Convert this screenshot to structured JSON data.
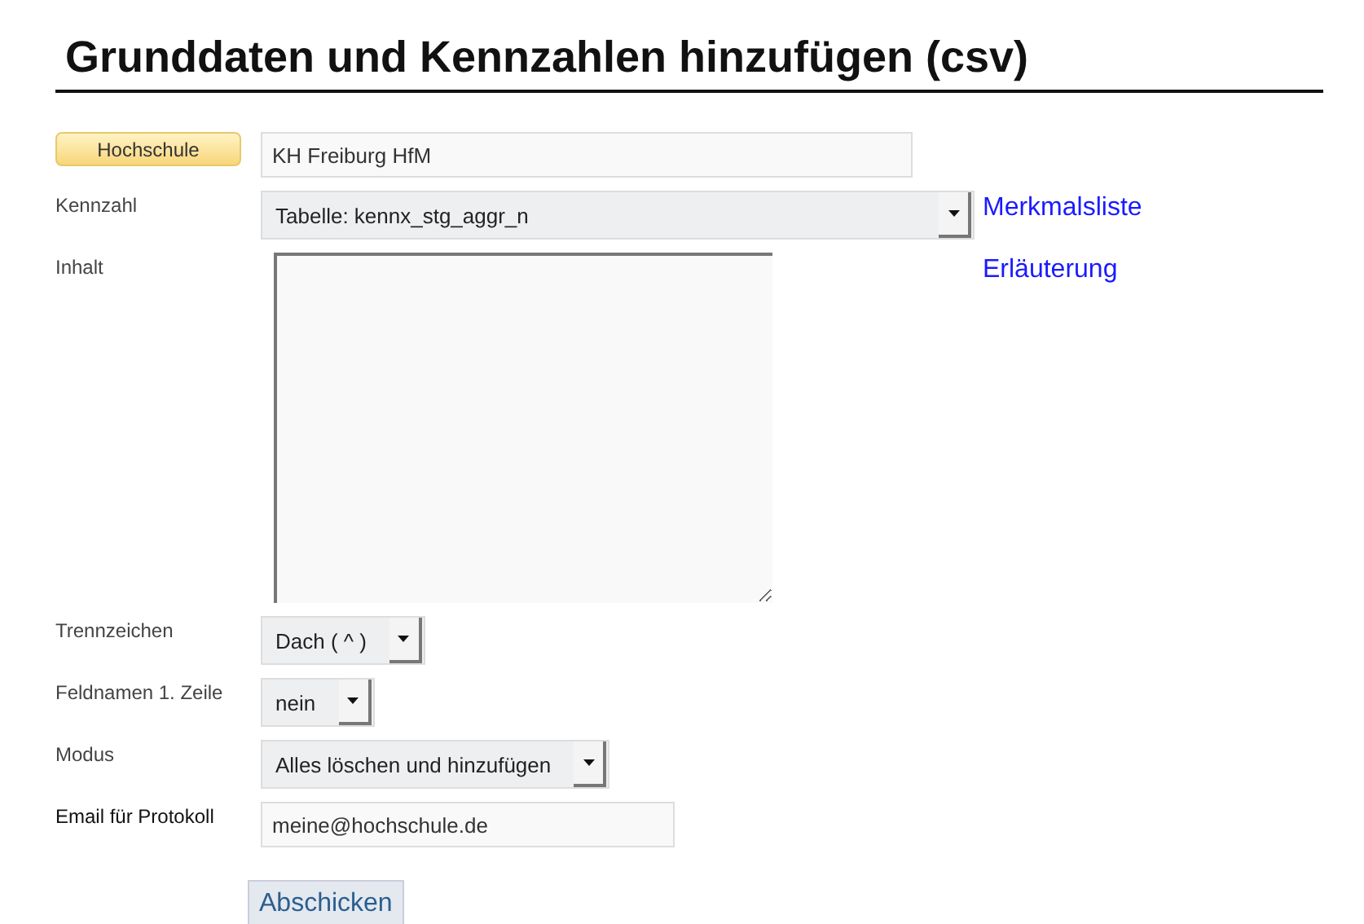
{
  "title": "Grunddaten und Kennzahlen hinzufügen (csv)",
  "fields": [
    {
      "label": {
        "kind": "button",
        "text": "Hochschule"
      },
      "kind": "text",
      "value": "KH Freiburg HfM"
    },
    {
      "label": {
        "kind": "text",
        "text": "Kennzahl"
      },
      "kind": "select",
      "value": "Tabelle: kennx_stg_aggr_n",
      "link": "Merkmalsliste"
    },
    {
      "label": {
        "kind": "text",
        "text": "Inhalt"
      },
      "kind": "textarea",
      "link": "Erläuterung"
    },
    {
      "label": {
        "kind": "text",
        "text": "Trennzeichen"
      },
      "kind": "select",
      "value": "Dach ( ^ )"
    },
    {
      "label": {
        "kind": "text",
        "text": "Feldnamen 1. Zeile"
      },
      "kind": "select",
      "value": "nein"
    },
    {
      "label": {
        "kind": "text",
        "text": "Modus"
      },
      "kind": "select",
      "value": "Alles löschen und hinzufügen"
    },
    {
      "label": {
        "kind": "strong",
        "text": "Email für Protokoll"
      },
      "kind": "text",
      "value": "meine@hochschule.de"
    }
  ],
  "submit": "Abschicken"
}
